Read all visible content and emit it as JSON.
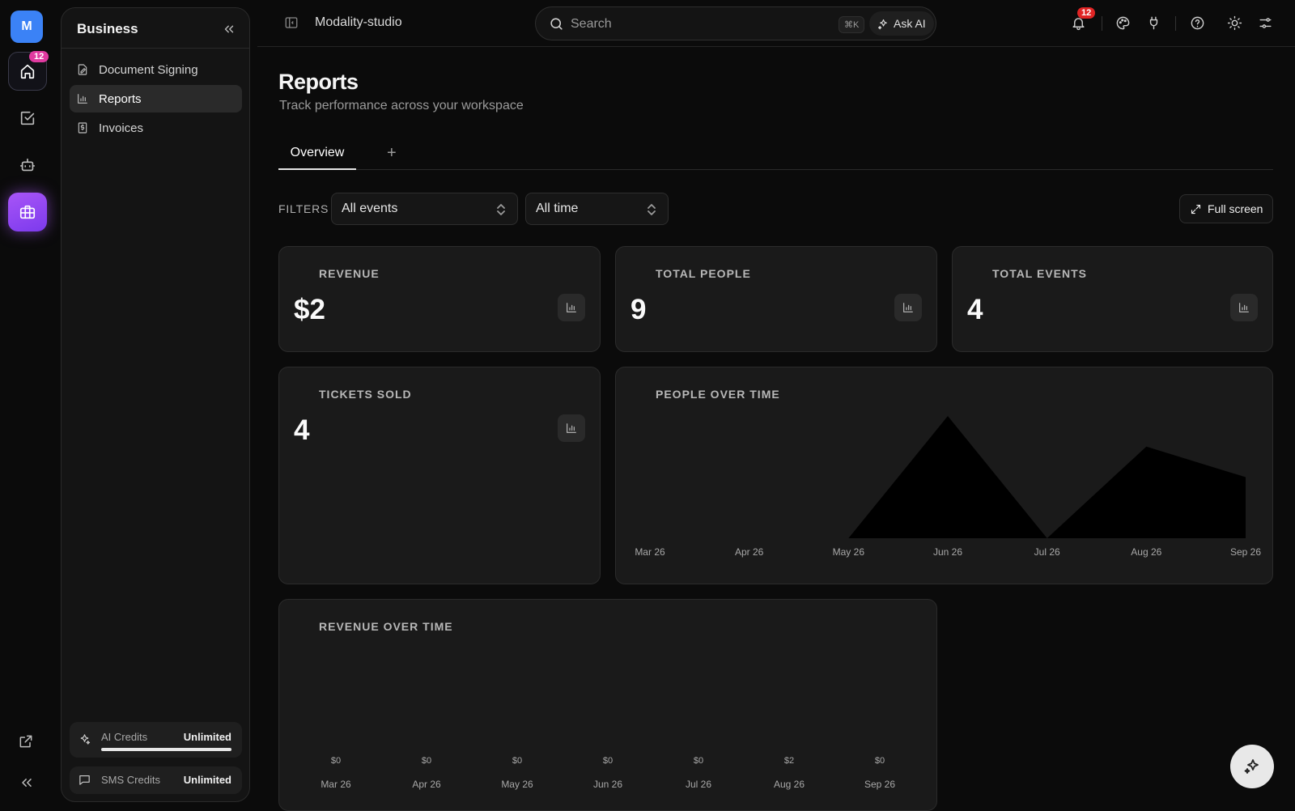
{
  "rail": {
    "avatar_initial": "M",
    "home_badge": "12",
    "icons": [
      "home-icon",
      "tasks-icon",
      "bot-icon",
      "briefcase-icon",
      "external-link-icon",
      "collapse-icon"
    ]
  },
  "sidebar": {
    "title": "Business",
    "items": [
      {
        "label": "Document Signing",
        "icon": "document-sign-icon"
      },
      {
        "label": "Reports",
        "icon": "bar-chart-icon",
        "active": true
      },
      {
        "label": "Invoices",
        "icon": "invoice-icon"
      }
    ],
    "credits": [
      {
        "label": "AI Credits",
        "value": "Unlimited",
        "progress": 1.0
      },
      {
        "label": "SMS Credits",
        "value": "Unlimited"
      }
    ]
  },
  "topbar": {
    "workspace": "Modality-studio",
    "search_placeholder": "Search",
    "shortcut": "⌘K",
    "ask_ai": "Ask AI",
    "notification_count": "12"
  },
  "page": {
    "title": "Reports",
    "subtitle": "Track performance across your workspace",
    "tabs": [
      {
        "label": "Overview",
        "active": true
      }
    ],
    "add_tab": "+",
    "filters_label": "FILTERS",
    "event_filter": "All events",
    "time_filter": "All time",
    "fullscreen_label": "Full screen"
  },
  "cards": {
    "revenue": {
      "label": "REVENUE",
      "value": "$2"
    },
    "total_people": {
      "label": "TOTAL PEOPLE",
      "value": "9"
    },
    "total_events": {
      "label": "TOTAL EVENTS",
      "value": "4"
    },
    "tickets_sold": {
      "label": "TICKETS SOLD",
      "value": "4"
    },
    "people_over_time": {
      "label": "PEOPLE OVER TIME"
    },
    "revenue_over_time": {
      "label": "REVENUE OVER TIME"
    }
  },
  "colors": {
    "accent": "#a855f7",
    "avatar": "#3b82f6",
    "badge": "#e02424",
    "background": "#0b0b0b",
    "card": "#1a1a1a"
  },
  "chart_data": [
    {
      "type": "area",
      "title": "PEOPLE OVER TIME",
      "categories": [
        "Mar 26",
        "Apr 26",
        "May 26",
        "Jun 26",
        "Jul 26",
        "Aug 26",
        "Sep 26"
      ],
      "values": [
        0,
        0,
        0,
        4,
        0,
        3,
        2
      ],
      "ylim": [
        0,
        4
      ],
      "grid": false,
      "legend": "none"
    },
    {
      "type": "bar",
      "title": "REVENUE OVER TIME",
      "categories": [
        "Mar 26",
        "Apr 26",
        "May 26",
        "Jun 26",
        "Jul 26",
        "Aug 26",
        "Sep 26"
      ],
      "values": [
        0,
        0,
        0,
        0,
        0,
        2,
        0
      ],
      "data_labels": [
        "$0",
        "$0",
        "$0",
        "$0",
        "$0",
        "$2",
        "$0"
      ],
      "grid": false,
      "legend": "none"
    }
  ]
}
